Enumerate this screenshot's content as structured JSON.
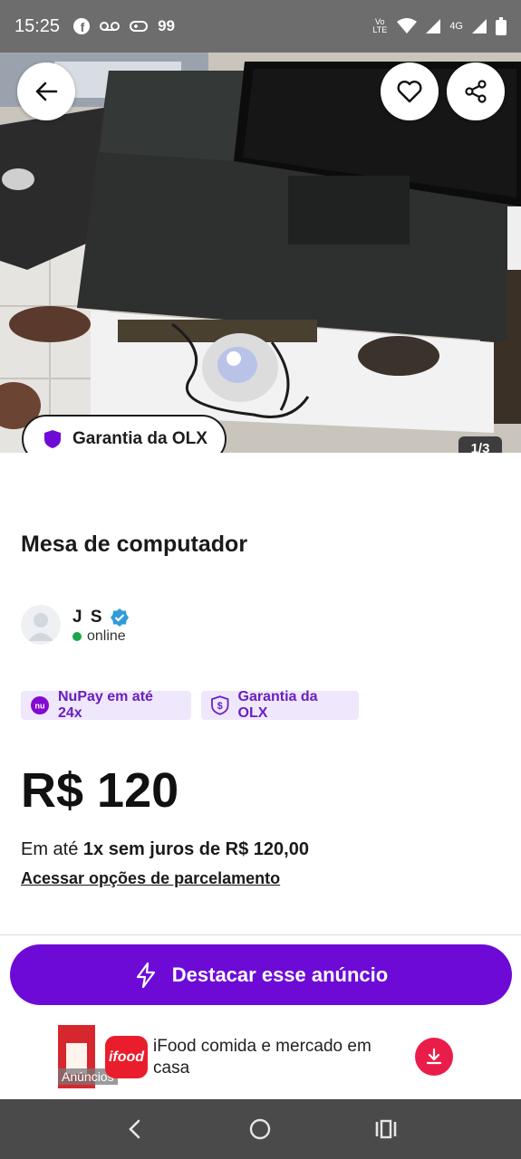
{
  "status_bar": {
    "time": "15:25",
    "notification_count": "99",
    "network_label": "4G",
    "volte_label": "Vo LTE"
  },
  "hero": {
    "image_counter": "1/3",
    "garantia_label": "Garantia da OLX"
  },
  "listing": {
    "title": "Mesa de computador",
    "seller_name": "J S",
    "seller_status": "online",
    "badges": {
      "nupay": "NuPay em até 24x",
      "nupay_logo": "nu",
      "garantia": "Garantia da OLX"
    },
    "price": "R$ 120",
    "installment_prefix": "Em até ",
    "installment_bold": "1x sem juros de R$ 120,00",
    "installment_link": "Acessar opções de parcelamento"
  },
  "cta": {
    "label": "Destacar esse anúncio"
  },
  "ad": {
    "logo_text": "ifood",
    "text": "iFood comida e mercado em casa",
    "label": "Anúncios"
  },
  "colors": {
    "brand_purple": "#6e0ad6",
    "badge_bg": "#efe7fb",
    "online_green": "#1aa64b",
    "ifood_red": "#ea1d2c"
  },
  "icons": {
    "back": "arrow-left-icon",
    "favorite": "heart-icon",
    "share": "share-icon",
    "garantia": "shield-icon",
    "verified": "verified-badge-icon",
    "highlight": "lightning-icon",
    "download": "download-icon"
  }
}
